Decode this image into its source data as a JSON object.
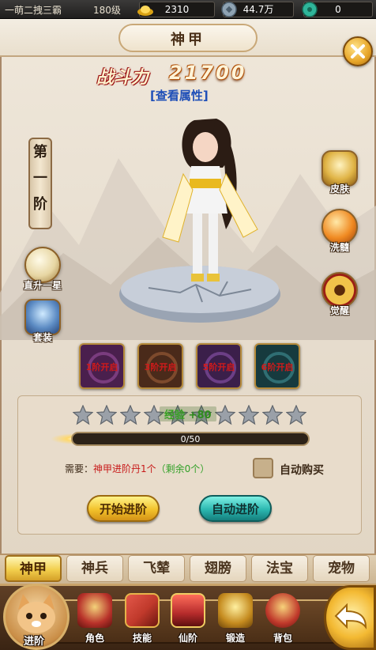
{
  "topbar": {
    "player_name": "一萌二拽三霸",
    "level": "180级",
    "gold": "2310",
    "silver": "44.7万",
    "jade": "0",
    "icons": [
      "gold-ingot-icon",
      "coin-icon",
      "jade-icon"
    ]
  },
  "header": {
    "title": "神甲",
    "close_icon": "close-icon"
  },
  "combat": {
    "label": "战斗力",
    "value": "21700",
    "view_attributes": "[查看属性]"
  },
  "stage": {
    "chars": [
      "第",
      "一",
      "阶"
    ]
  },
  "left_actions": [
    {
      "label": "直升一星",
      "icon": "pearl-icon"
    },
    {
      "label": "套装",
      "icon": "armor-icon"
    }
  ],
  "right_actions": [
    {
      "label": "皮肤",
      "icon": "mask-icon"
    },
    {
      "label": "洗髓",
      "icon": "orb-icon"
    },
    {
      "label": "觉醒",
      "icon": "ring-icon"
    }
  ],
  "material_slots": [
    {
      "label": "1阶开启",
      "color": "#4a1f4d"
    },
    {
      "label": "3阶开启",
      "color": "#4a2a1a"
    },
    {
      "label": "5阶开启",
      "color": "#3b1f4a"
    },
    {
      "label": "6阶开启",
      "color": "#163a3e"
    }
  ],
  "progress": {
    "stars_total": 10,
    "stars_filled": 0,
    "exp_label": "经验",
    "exp_gain": "+80",
    "current": 0,
    "max": 50,
    "bar_text": "0/50"
  },
  "requirement": {
    "prefix": "需要：",
    "item": "神甲进阶丹1个",
    "remaining": "（剩余0个）",
    "auto_buy_label": "自动购买"
  },
  "buttons": {
    "start": "开始进阶",
    "auto": "自动进阶"
  },
  "tabs": [
    "神甲",
    "神兵",
    "飞辇",
    "翅膀",
    "法宝",
    "宠物"
  ],
  "active_tab": 0,
  "nav": {
    "pet_label": "进阶",
    "items": [
      {
        "label": "角色",
        "icon": "helmet-icon",
        "color": "#b8322a"
      },
      {
        "label": "技能",
        "icon": "book-icon",
        "color": "#c0392b"
      },
      {
        "label": "仙阶",
        "icon": "immortal-seal-icon",
        "color": "#b52b2b"
      },
      {
        "label": "锻造",
        "icon": "anvil-icon",
        "color": "#c58b1f"
      },
      {
        "label": "背包",
        "icon": "bag-icon",
        "color": "#c0392b"
      }
    ],
    "back_icon": "back-arrow-icon"
  }
}
